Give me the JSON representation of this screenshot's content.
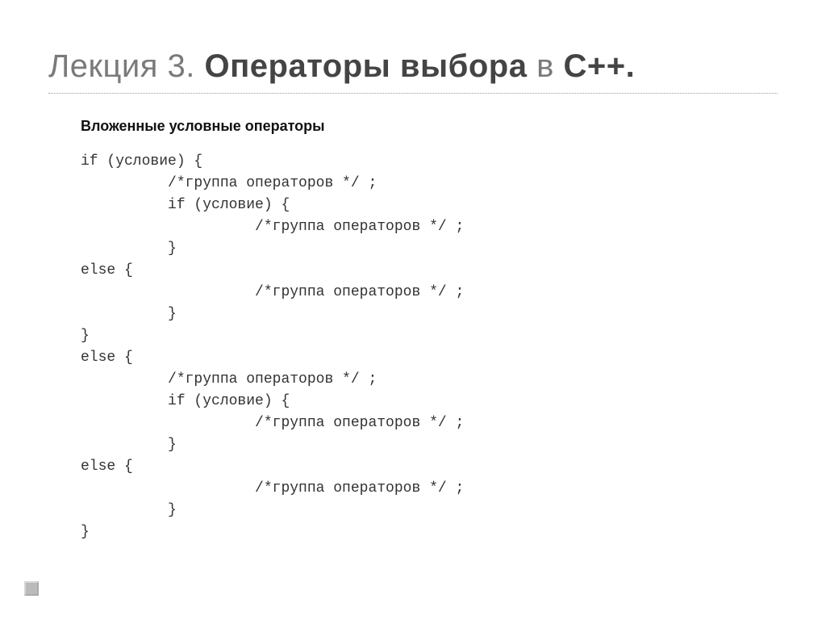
{
  "title": {
    "prefix": "Лекция 3. ",
    "emph1": "Операторы выбора",
    "mid": " в ",
    "emph2": "С++."
  },
  "subheading": "Вложенные условные операторы",
  "code": "if (условие) {\n          /*группа операторов */ ;\n          if (условие) {\n                    /*группа операторов */ ;\n          }\nelse {\n                    /*группа операторов */ ;\n          }\n}\nelse {\n          /*группа операторов */ ;\n          if (условие) {\n                    /*группа операторов */ ;\n          }\nelse {\n                    /*группа операторов */ ;\n          }\n}"
}
